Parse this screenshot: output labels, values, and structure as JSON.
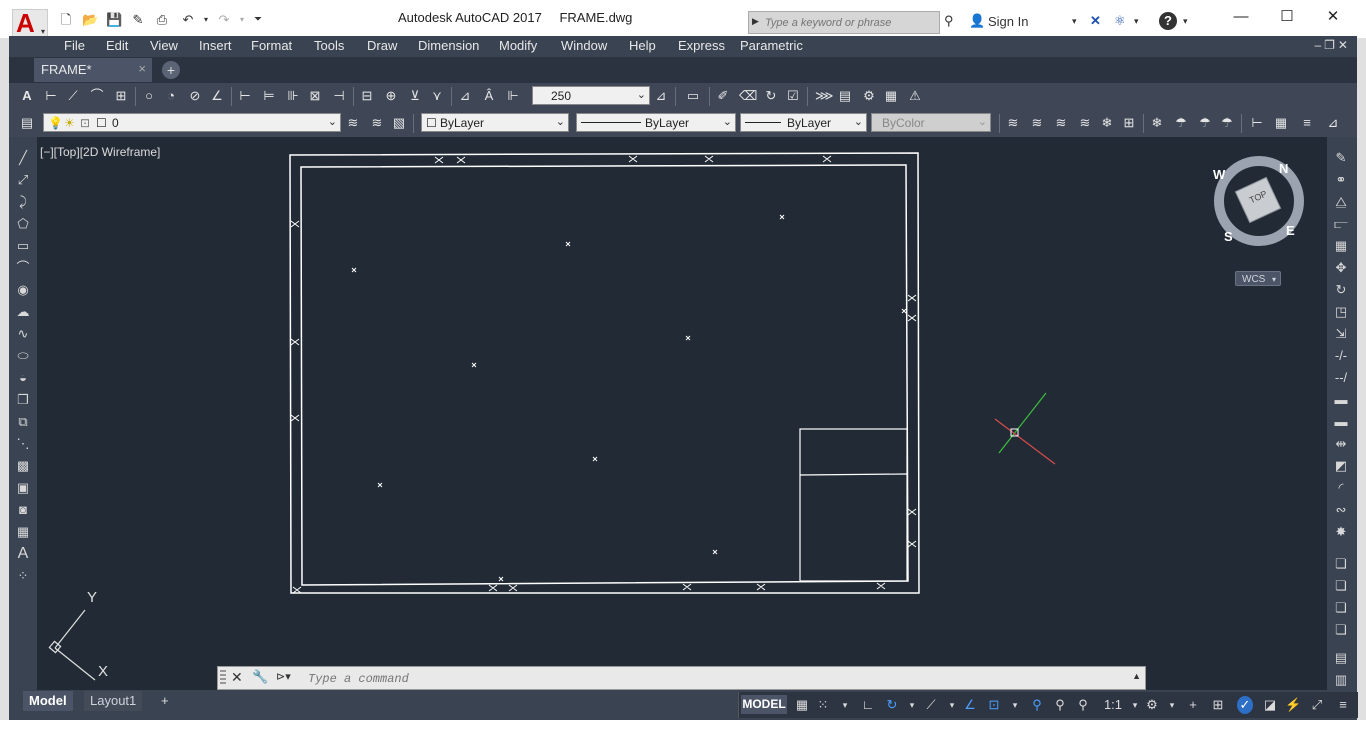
{
  "app": {
    "title": "Autodesk AutoCAD 2017",
    "file": "FRAME.dwg",
    "search_placeholder": "Type a keyword or phrase",
    "sign_in": "Sign In",
    "help": "?"
  },
  "menu": [
    "File",
    "Edit",
    "View",
    "Insert",
    "Format",
    "Tools",
    "Draw",
    "Dimension",
    "Modify",
    "Window",
    "Help",
    "Express",
    "Parametric"
  ],
  "tabs": {
    "document": "FRAME*",
    "close": "×",
    "new": "+"
  },
  "toolbar": {
    "dim_scale": "250",
    "layer": "0",
    "color": "ByLayer",
    "linetype": "ByLayer",
    "lineweight": "ByLayer",
    "plotstyle": "ByColor"
  },
  "viewport": {
    "label": "[−][Top][2D Wireframe]",
    "viewcube": {
      "face": "TOP",
      "north": "N",
      "south": "S",
      "east": "E",
      "west": "W",
      "ucs": "WCS"
    },
    "ucs_icon": {
      "x": "X",
      "y": "Y"
    }
  },
  "command": {
    "placeholder": "Type a command"
  },
  "status": {
    "layout_tabs": [
      "Model",
      "Layout1"
    ],
    "add_tab": "+",
    "model": "MODEL",
    "scale": "1:1"
  }
}
